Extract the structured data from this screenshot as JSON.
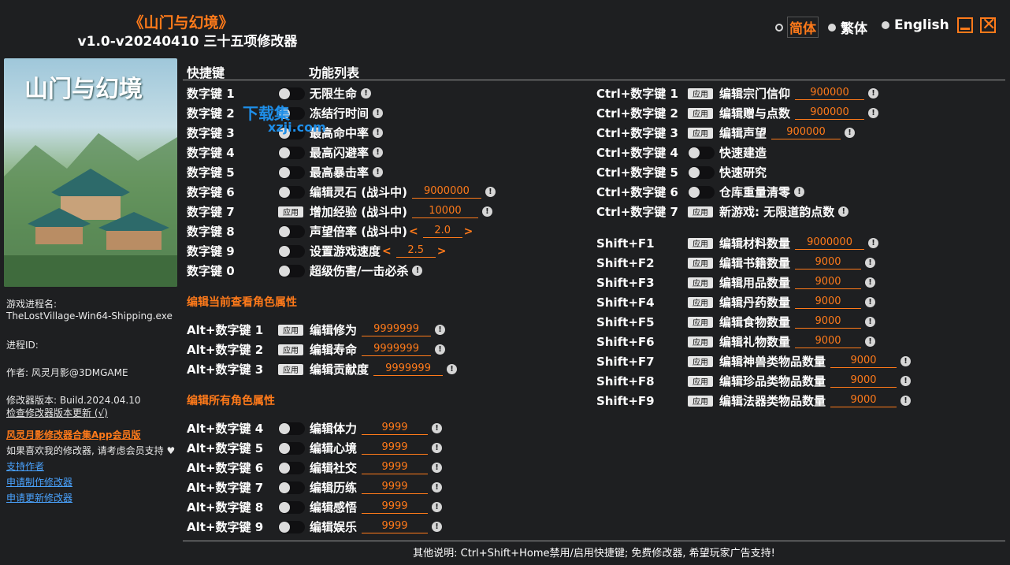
{
  "header": {
    "title": "《山门与幻境》",
    "subtitle": "v1.0-v20240410 三十五项修改器"
  },
  "languages": [
    {
      "label": "简体",
      "selected": true
    },
    {
      "label": "繁体",
      "selected": false
    },
    {
      "label": "English",
      "selected": false
    }
  ],
  "colors": {
    "accent": "#ff7a1a",
    "background": "#1e1f21",
    "link": "#4aa3ff"
  },
  "left": {
    "process_label": "游戏进程名:",
    "process_value": "TheLostVillage-Win64-Shipping.exe",
    "pid_label": "进程ID:",
    "author": "作者: 风灵月影@3DMGAME",
    "version": "修改器版本: Build.2024.04.10",
    "check_update": "检查修改器版本更新 (√)",
    "vip_link": "风灵月影修改器合集App会员版",
    "support_text": "如果喜欢我的修改器, 请考虑会员支持",
    "heart": "♥",
    "links": [
      "支持作者",
      "申请制作修改器",
      "申请更新修改器"
    ],
    "cover_title": "山门与幻境"
  },
  "watermark": {
    "text": "下载集",
    "sub": "xzji.com"
  },
  "main": {
    "hotkey_header": "快捷键",
    "feature_header": "功能列表",
    "section_current": "编辑当前查看角色属性",
    "section_all": "编辑所有角色属性",
    "apply_label": "应用",
    "info_glyph": "!",
    "left_rows": [
      {
        "key": "数字键 1",
        "type": "toggle",
        "label": "无限生命",
        "info": true
      },
      {
        "key": "数字键 2",
        "type": "toggle",
        "label": "冻结行时间",
        "info": true
      },
      {
        "key": "数字键 3",
        "type": "toggle",
        "label": "最高命中率",
        "info": true
      },
      {
        "key": "数字键 4",
        "type": "toggle",
        "label": "最高闪避率",
        "info": true
      },
      {
        "key": "数字键 5",
        "type": "toggle",
        "label": "最高暴击率",
        "info": true
      },
      {
        "key": "数字键 6",
        "type": "toggle",
        "label": "编辑灵石 (战斗中)",
        "value": "9000000",
        "info": true
      },
      {
        "key": "数字键 7",
        "type": "apply",
        "label": "增加经验 (战斗中)",
        "value": "10000",
        "info": true
      },
      {
        "key": "数字键 8",
        "type": "toggle",
        "label": "声望倍率 (战斗中)",
        "stepper": "2.0"
      },
      {
        "key": "数字键 9",
        "type": "toggle",
        "label": "设置游戏速度",
        "stepper": "2.5"
      },
      {
        "key": "数字键 0",
        "type": "toggle",
        "label": "超级伤害/一击必杀",
        "info": true
      }
    ],
    "current_rows": [
      {
        "key": "Alt+数字键 1",
        "type": "apply",
        "label": "编辑修为",
        "value": "9999999",
        "info": true
      },
      {
        "key": "Alt+数字键 2",
        "type": "apply",
        "label": "编辑寿命",
        "value": "9999999",
        "info": true
      },
      {
        "key": "Alt+数字键 3",
        "type": "apply",
        "label": "编辑贡献度",
        "value": "9999999",
        "info": true
      }
    ],
    "all_rows": [
      {
        "key": "Alt+数字键 4",
        "type": "toggle",
        "label": "编辑体力",
        "value": "9999",
        "info": true
      },
      {
        "key": "Alt+数字键 5",
        "type": "toggle",
        "label": "编辑心境",
        "value": "9999",
        "info": true
      },
      {
        "key": "Alt+数字键 6",
        "type": "toggle",
        "label": "编辑社交",
        "value": "9999",
        "info": true
      },
      {
        "key": "Alt+数字键 7",
        "type": "toggle",
        "label": "编辑历练",
        "value": "9999",
        "info": true
      },
      {
        "key": "Alt+数字键 8",
        "type": "toggle",
        "label": "编辑感悟",
        "value": "9999",
        "info": true
      },
      {
        "key": "Alt+数字键 9",
        "type": "toggle",
        "label": "编辑娱乐",
        "value": "9999",
        "info": true
      }
    ],
    "ctrl_rows": [
      {
        "key": "Ctrl+数字键 1",
        "type": "apply",
        "label": "编辑宗门信仰",
        "value": "900000",
        "info": true
      },
      {
        "key": "Ctrl+数字键 2",
        "type": "apply",
        "label": "编辑赠与点数",
        "value": "900000",
        "info": true
      },
      {
        "key": "Ctrl+数字键 3",
        "type": "apply",
        "label": "编辑声望",
        "value": "900000",
        "info": true
      },
      {
        "key": "Ctrl+数字键 4",
        "type": "toggle",
        "label": "快速建造"
      },
      {
        "key": "Ctrl+数字键 5",
        "type": "toggle",
        "label": "快速研究"
      },
      {
        "key": "Ctrl+数字键 6",
        "type": "toggle",
        "label": "仓库重量清零",
        "info": true
      },
      {
        "key": "Ctrl+数字键 7",
        "type": "apply",
        "label": "新游戏: 无限道韵点数",
        "info": true
      }
    ],
    "shift_rows": [
      {
        "key": "Shift+F1",
        "type": "apply",
        "label": "编辑材料数量",
        "value": "9000000",
        "info": true
      },
      {
        "key": "Shift+F2",
        "type": "apply",
        "label": "编辑书籍数量",
        "value": "9000",
        "info": true
      },
      {
        "key": "Shift+F3",
        "type": "apply",
        "label": "编辑用品数量",
        "value": "9000",
        "info": true
      },
      {
        "key": "Shift+F4",
        "type": "apply",
        "label": "编辑丹药数量",
        "value": "9000",
        "info": true
      },
      {
        "key": "Shift+F5",
        "type": "apply",
        "label": "编辑食物数量",
        "value": "9000",
        "info": true
      },
      {
        "key": "Shift+F6",
        "type": "apply",
        "label": "编辑礼物数量",
        "value": "9000",
        "info": true
      },
      {
        "key": "Shift+F7",
        "type": "apply",
        "label": "编辑神兽类物品数量",
        "value": "9000",
        "info": true
      },
      {
        "key": "Shift+F8",
        "type": "apply",
        "label": "编辑珍品类物品数量",
        "value": "9000",
        "info": true
      },
      {
        "key": "Shift+F9",
        "type": "apply",
        "label": "编辑法器类物品数量",
        "value": "9000",
        "info": true
      }
    ]
  },
  "footer": "其他说明: Ctrl+Shift+Home禁用/启用快捷键; 免费修改器, 希望玩家广告支持!"
}
